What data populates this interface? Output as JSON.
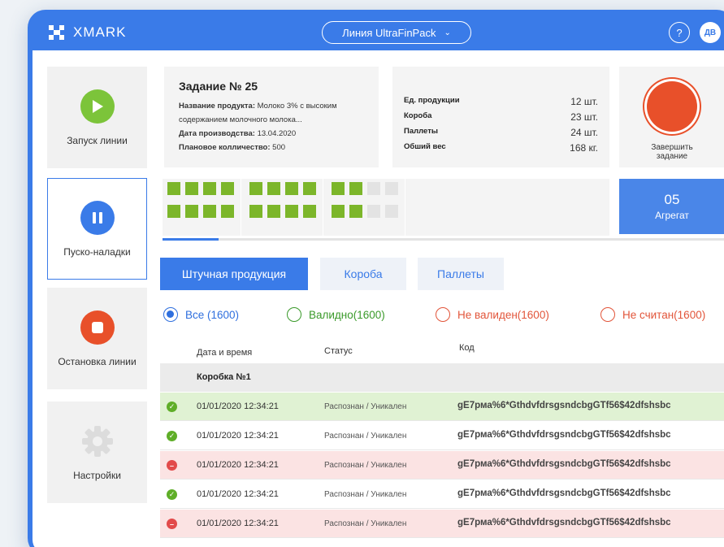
{
  "app": {
    "logo_text": "XMARK",
    "line_select": "Линия UltraFinPack",
    "help": "?",
    "user_initials": "ДВ"
  },
  "sidebar": {
    "items": [
      {
        "label": "Запуск линии",
        "icon": "play-icon",
        "color": "#7cc43a"
      },
      {
        "label": "Пуско-наладки",
        "icon": "pause-icon",
        "color": "#3a7be8"
      },
      {
        "label": "Остановка линии",
        "icon": "stop-icon",
        "color": "#e8502a"
      },
      {
        "label": "Настройки",
        "icon": "gear-icon",
        "color": "#dcdcdc"
      }
    ]
  },
  "task": {
    "title": "Задание № 25",
    "product_name_label": "Название продукта:",
    "product_name": "Молоко 3% с высоким содержанием молочного молока...",
    "production_date_label": "Дата производства:",
    "production_date": "13.04.2020",
    "planned_quantity_label": "Плановое колличество:",
    "planned_quantity": "500"
  },
  "stats": [
    {
      "label": "Ед. продукции",
      "value": "12 шт."
    },
    {
      "label": "Короба",
      "value": "23 шт."
    },
    {
      "label": "Паллеты",
      "value": "24 шт."
    },
    {
      "label": "Обший вес",
      "value": "168 кг."
    }
  ],
  "finish": {
    "label_line1": "Завершить",
    "label_line2": "задание"
  },
  "aggregate": {
    "number": "05",
    "label": "Агрегат"
  },
  "grid": {
    "groups_filled": [
      8,
      8,
      4
    ],
    "cells_per_group": 8,
    "progress_fraction": 0.1
  },
  "tabs": [
    {
      "label": "Штучная продукция",
      "active": true
    },
    {
      "label": "Короба",
      "active": false
    },
    {
      "label": "Паллеты",
      "active": false
    }
  ],
  "filters": [
    {
      "label": "Все (1600)",
      "checked": true,
      "color": "#2f6fde"
    },
    {
      "label": "Валидно(1600)",
      "checked": false,
      "color": "#3a9a2a"
    },
    {
      "label": "Не валиден(1600)",
      "checked": false,
      "color": "#e2553a"
    },
    {
      "label": "Не считан(1600)",
      "checked": false,
      "color": "#e2553a"
    }
  ],
  "table": {
    "headers": {
      "datetime": "Дата и время",
      "status": "Статус",
      "code": "Код"
    },
    "group_label": "Коробка №1",
    "rows": [
      {
        "state": "ok",
        "highlight": true,
        "datetime": "01/01/2020 12:34:21",
        "status": "Распознан / Уникален",
        "code": "gE7рма%6*GthdvfdrsgsndcbgGTf56$42dfshsbc"
      },
      {
        "state": "ok",
        "highlight": false,
        "datetime": "01/01/2020 12:34:21",
        "status": "Распознан / Уникален",
        "code": "gE7рма%6*GthdvfdrsgsndcbgGTf56$42dfshsbc"
      },
      {
        "state": "error",
        "highlight": true,
        "datetime": "01/01/2020 12:34:21",
        "status": "Распознан / Уникален",
        "code": "gE7рма%6*GthdvfdrsgsndcbgGTf56$42dfshsbc"
      },
      {
        "state": "ok",
        "highlight": false,
        "datetime": "01/01/2020 12:34:21",
        "status": "Распознан / Уникален",
        "code": "gE7рма%6*GthdvfdrsgsndcbgGTf56$42dfshsbc"
      },
      {
        "state": "error",
        "highlight": true,
        "datetime": "01/01/2020 12:34:21",
        "status": "Распознан / Уникален",
        "code": "gE7рма%6*GthdvfdrsgsndcbgGTf56$42dfshsbc"
      }
    ]
  }
}
